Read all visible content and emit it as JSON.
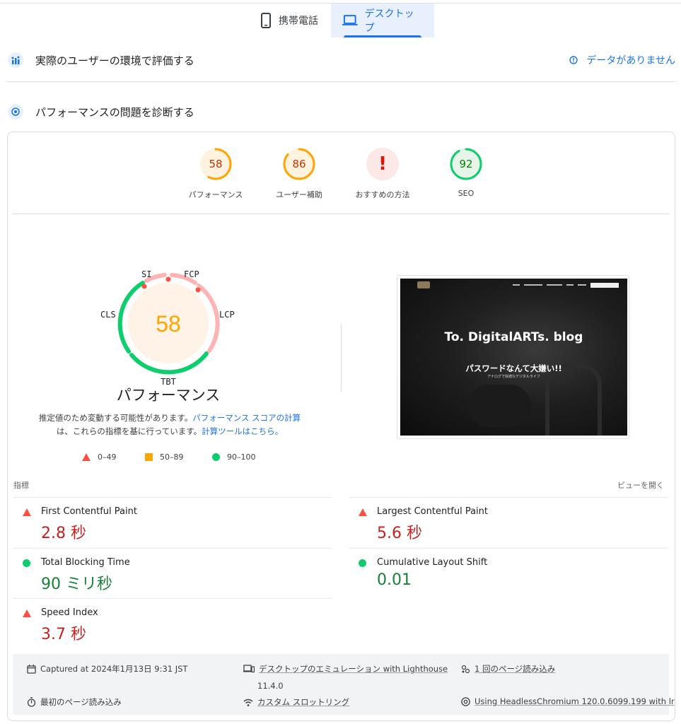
{
  "tabs": {
    "mobile": "携帯電話",
    "desktop": "デスクトップ"
  },
  "field_section": {
    "title": "実際のユーザーの環境で評価する",
    "no_data": "データがありません"
  },
  "lab_section": {
    "title": "パフォーマンスの問題を診断する"
  },
  "scores": [
    {
      "label": "パフォーマンス",
      "value": "58",
      "fraction": 0.58,
      "status": "average"
    },
    {
      "label": "ユーザー補助",
      "value": "86",
      "fraction": 0.86,
      "status": "average"
    },
    {
      "label": "おすすめの方法",
      "value": "!",
      "status": "fail"
    },
    {
      "label": "SEO",
      "value": "92",
      "fraction": 0.92,
      "status": "pass"
    }
  ],
  "performance": {
    "score": "58",
    "title": "パフォーマンス",
    "arc_labels": {
      "si": "SI",
      "fcp": "FCP",
      "lcp": "LCP",
      "tbt": "TBT",
      "cls": "CLS"
    },
    "note_prefix": "推定値のため変動する可能性があります。",
    "note_link1": "パフォーマンス スコアの計算",
    "note_middle": "は、これらの指標を基に行っています。",
    "note_link2": "計算ツールはこちら。"
  },
  "legend": {
    "fail": "0–49",
    "average": "50–89",
    "pass": "90–100"
  },
  "screenshot": {
    "blog_title": "To. DigitalARTs. blog",
    "subtitle": "パスワードなんて大嫌い!!",
    "subsubtitle": "アナログで快適なデジタルライフ"
  },
  "metrics_header": {
    "left": "指標",
    "right": "ビューを開く"
  },
  "metrics": {
    "fcp": {
      "label": "First Contentful Paint",
      "value": "2.8 秒",
      "status": "fail"
    },
    "lcp": {
      "label": "Largest Contentful Paint",
      "value": "5.6 秒",
      "status": "fail"
    },
    "tbt": {
      "label": "Total Blocking Time",
      "value": "90 ミリ秒",
      "status": "pass"
    },
    "cls": {
      "label": "Cumulative Layout Shift",
      "value": "0.01",
      "status": "pass"
    },
    "si": {
      "label": "Speed Index",
      "value": "3.7 秒",
      "status": "fail"
    }
  },
  "footer": {
    "captured": "Captured at 2024年1月13日 9:31 JST",
    "emulation": "デスクトップのエミュレーション with Lighthouse",
    "emulation_version": "11.4.0",
    "page_loads": "1 回のページ読み込み",
    "initial_load": "最初のページ読み込み",
    "throttling": "カスタム スロットリング",
    "browser": "Using HeadlessChromium 120.0.6099.199 with lr"
  },
  "colors": {
    "fail": "#ff4e42",
    "average": "#ffa400",
    "pass": "#0cce6b",
    "link": "#1a73e8"
  }
}
